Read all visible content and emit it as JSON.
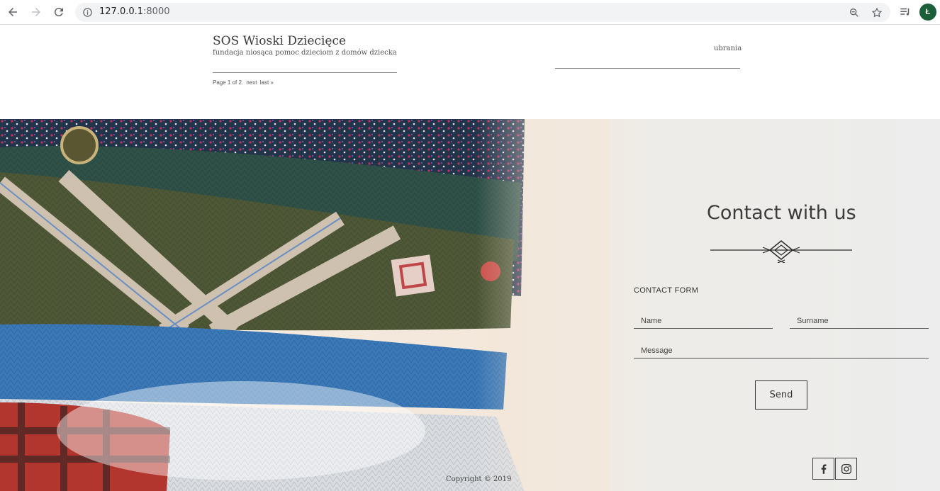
{
  "browser": {
    "url_host": "127.0.0.1",
    "url_port": ":8000",
    "profile_initial": "Ł"
  },
  "site": {
    "title": "SOS Wioski Dziecięce",
    "description": "fundacja niosąca pomoc dzieciom z domów dziecka",
    "pagination": {
      "text": "Page 1 of 2.",
      "next": "next",
      "last": "last »"
    },
    "nav_link": "ubrania"
  },
  "contact": {
    "title": "Contact with us",
    "form_label": "CONTACT FORM",
    "name_placeholder": "Name",
    "surname_placeholder": "Surname",
    "message_placeholder": "Message",
    "send_label": "Send"
  },
  "footer": {
    "copyright": "Copyright © 2019"
  },
  "icons": {
    "back": "arrow-left-icon",
    "forward": "arrow-right-icon",
    "reload": "reload-icon",
    "info": "info-icon",
    "zoom": "zoom-icon",
    "star": "star-icon",
    "media": "media-queue-icon",
    "facebook": "facebook-icon",
    "instagram": "instagram-icon"
  }
}
